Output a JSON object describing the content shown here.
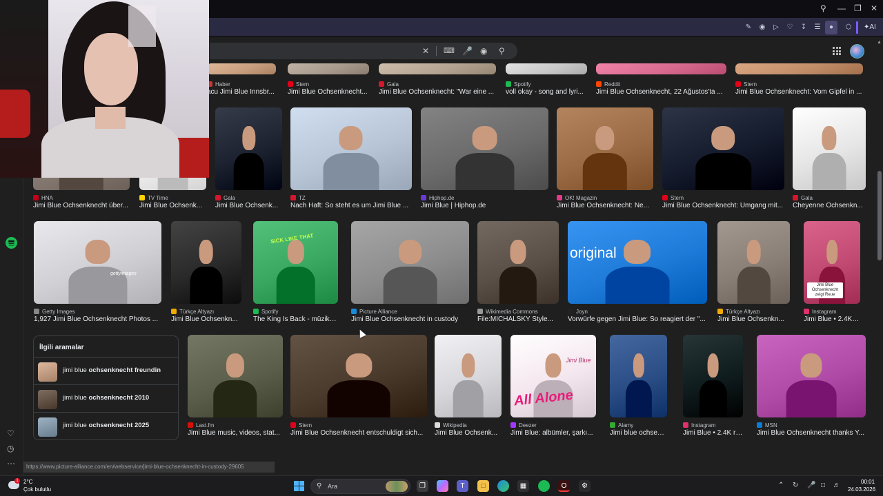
{
  "search": {
    "icons": [
      "close-icon",
      "keyboard-icon",
      "mic-icon",
      "lens-icon",
      "search-icon"
    ]
  },
  "row1": [
    {
      "source": "Haber",
      "title": "acu Jimi Blue Innsbr...",
      "color": "#c8a080"
    },
    {
      "source": "Stern",
      "title": "Jimi Blue Ochsenknecht...",
      "color": "#a89a8c"
    },
    {
      "source": "Gala",
      "title": "Jimi Blue Ochsenknecht: \"War eine ...",
      "color": "#b5a492"
    },
    {
      "source": "Spotify",
      "title": "voll okay - song and lyri...",
      "color": "#c9c9c9"
    },
    {
      "source": "Reddit",
      "title": "Jimi Blue Ochsenknecht, 22 Ağustos'ta ...",
      "color": "#d86a8f"
    },
    {
      "source": "Stern",
      "title": "Jimi Blue Ochsenknecht: Vom Gipfel in ...",
      "color": "#c28e6a"
    }
  ],
  "row2": [
    {
      "source": "HNA",
      "title": "Jimi Blue Ochsenknecht über...",
      "color": "#8a7e76"
    },
    {
      "source": "TV Time",
      "title": "Jimi Blue Ochsenk...",
      "color": "#f2f2f2"
    },
    {
      "source": "Gala",
      "title": "Jimi Blue Ochsenk...",
      "color": "#1c2230"
    },
    {
      "source": "TZ",
      "title": "Nach Haft: So steht es um Jimi Blue ...",
      "color": "#b7c5d6"
    },
    {
      "source": "Hiphop.de",
      "title": "Jimi Blue | Hiphop.de",
      "color": "#6a6a6a"
    },
    {
      "source": "OK! Magazin",
      "title": "Jimi Blue Ochsenknecht: Ne...",
      "color": "#9b6b45"
    },
    {
      "source": "Stern",
      "title": "Jimi Blue Ochsenknecht: Umgang mit...",
      "color": "#141b2c"
    },
    {
      "source": "Gala",
      "title": "Cheyenne Ochsenkn...",
      "color": "#e6e6e6"
    }
  ],
  "row3": [
    {
      "source": "Getty Images",
      "title": "1,927 Jimi Blue Ochsenknecht Photos ...",
      "color": "#d0d0d4"
    },
    {
      "source": "Türkçe Altyazı",
      "title": "Jimi Blue Ochsenkn...",
      "color": "#2a2a2a"
    },
    {
      "source": "Spotify",
      "title": "The King Is Back - müzik v...",
      "color": "#3aa860"
    },
    {
      "source": "Picture Alliance",
      "title": "Jimi Blue Ochsenknecht in custody",
      "color": "#8d8d8d"
    },
    {
      "source": "Wikimedia Commons",
      "title": "File:MICHALSKY Style...",
      "color": "#5a5048"
    },
    {
      "source": "Joyn",
      "title": "Vorwürfe gegen Jimi Blue: So reagiert der \"...",
      "color": "#1f7bd8"
    },
    {
      "source": "Türkçe Altyazı",
      "title": "Jimi Blue Ochsenkn...",
      "color": "#8a7f76"
    },
    {
      "source": "Instagram",
      "title": "Jimi Blue • 2.4K re...",
      "color": "#c04a72"
    }
  ],
  "row3_overlay_texts": {
    "getty": "gettyimages",
    "spotify_banner": "SICK LIKE THAT",
    "joyn_banner": "original",
    "instagram_caption": "Jimi Blue Ochsenknecht zeigt Reue"
  },
  "related": {
    "title": "İlgili aramalar",
    "items": [
      {
        "prefix": "jimi blue",
        "bold": "ochsenknecht freundin",
        "color": "#c9a48a"
      },
      {
        "prefix": "jimi blue",
        "bold": "ochsenknecht 2010",
        "color": "#6a5a4e"
      },
      {
        "prefix": "jimi blue",
        "bold": "ochsenknecht 2025",
        "color": "#8a9fb0"
      }
    ]
  },
  "row4": [
    {
      "source": "Last.fm",
      "title": "Jimi Blue music, videos, stat...",
      "color": "#5a5e4a"
    },
    {
      "source": "Stern",
      "title": "Jimi Blue Ochsenknecht entschuldigt sich...",
      "color": "#4a3a2c"
    },
    {
      "source": "Wikipedia",
      "title": "Jimi Blue Ochsenk...",
      "color": "#d8d8dc"
    },
    {
      "source": "Deezer",
      "title": "Jimi Blue: albümler, şarkı...",
      "color": "#f4e6ee"
    },
    {
      "source": "Alamy",
      "title": "Jimi blue ochsenkn...",
      "color": "#2c4e86"
    },
    {
      "source": "Instagram",
      "title": "Jimi Blue • 2.4K re...",
      "color": "#0f1c1e"
    },
    {
      "source": "MSN",
      "title": "Jimi Blue Ochsenknecht thanks Y...",
      "color": "#b04ca8"
    }
  ],
  "row4_overlay_texts": {
    "deezer_album": "All Alone",
    "deezer_brand": "Jimi Blue"
  },
  "status_url": "https://www.picture-alliance.com/en/webservice/jimi-blue-ochsenknecht-in-custody-29605",
  "taskbar": {
    "weather_temp": "2°C",
    "weather_desc": "Çok bulutlu",
    "weather_badge": "1",
    "search_label": "Ara",
    "time": "00:01",
    "date": "24.03.2026"
  },
  "toolbar": {
    "ai_label": "AI"
  }
}
